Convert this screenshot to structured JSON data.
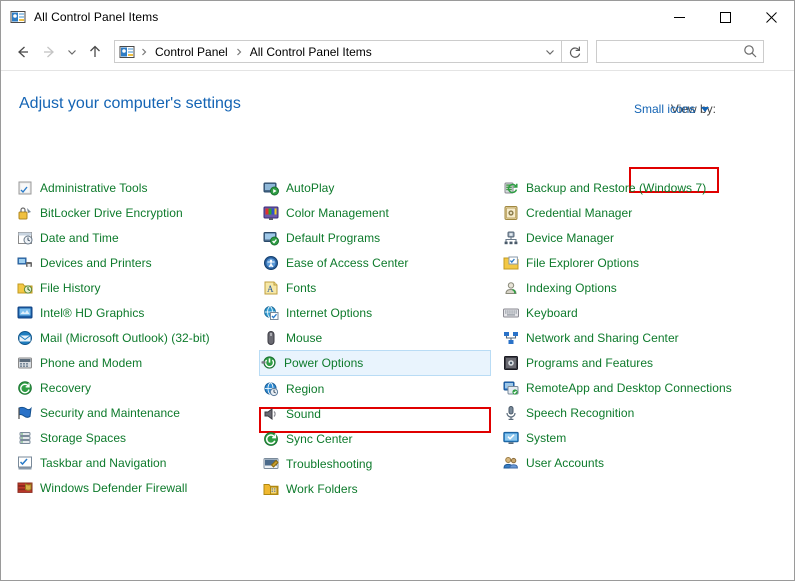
{
  "window": {
    "title": "All Control Panel Items",
    "icon": "control-panel-icon",
    "buttons": {
      "minimize": "minimize-icon",
      "maximize": "maximize-icon",
      "close": "close-icon"
    }
  },
  "navbar": {
    "back": "back-arrow-icon",
    "forward": "forward-arrow-icon",
    "recent": "recent-locations-icon",
    "up": "up-arrow-icon",
    "refresh": "refresh-icon",
    "breadcrumbs": [
      "Control Panel",
      "All Control Panel Items"
    ],
    "address_dropdown": "chevron-down-icon",
    "search": {
      "value": "",
      "placeholder": "",
      "icon": "search-icon"
    }
  },
  "header": {
    "page_title": "Adjust your computer's settings",
    "view_by_label": "View by:",
    "view_by_value": "Small icons"
  },
  "colors": {
    "link_green": "#0d7a2b",
    "heading_blue": "#1464b4",
    "accent_blue": "#1464b4",
    "annotation_red": "#e00000",
    "selection_fill": "#e9f4fd",
    "selection_border": "#b9dcf5"
  },
  "annotations": [
    {
      "name": "view-by-highlight",
      "target": "Small icons"
    },
    {
      "name": "power-options-highlight",
      "target": "Power Options"
    }
  ],
  "selected_item": "Power Options",
  "columns": [
    {
      "items": [
        {
          "label": "Administrative Tools",
          "icon": "administrative-tools-icon"
        },
        {
          "label": "BitLocker Drive Encryption",
          "icon": "bitlocker-icon"
        },
        {
          "label": "Date and Time",
          "icon": "date-and-time-icon"
        },
        {
          "label": "Devices and Printers",
          "icon": "devices-and-printers-icon"
        },
        {
          "label": "File History",
          "icon": "file-history-icon"
        },
        {
          "label": "Intel® HD Graphics",
          "icon": "intel-hd-graphics-icon"
        },
        {
          "label": "Mail (Microsoft Outlook) (32-bit)",
          "icon": "mail-icon"
        },
        {
          "label": "Phone and Modem",
          "icon": "phone-and-modem-icon"
        },
        {
          "label": "Recovery",
          "icon": "recovery-icon"
        },
        {
          "label": "Security and Maintenance",
          "icon": "security-and-maintenance-icon"
        },
        {
          "label": "Storage Spaces",
          "icon": "storage-spaces-icon"
        },
        {
          "label": "Taskbar and Navigation",
          "icon": "taskbar-and-navigation-icon"
        },
        {
          "label": "Windows Defender Firewall",
          "icon": "windows-defender-firewall-icon"
        }
      ]
    },
    {
      "items": [
        {
          "label": "AutoPlay",
          "icon": "autoplay-icon"
        },
        {
          "label": "Color Management",
          "icon": "color-management-icon"
        },
        {
          "label": "Default Programs",
          "icon": "default-programs-icon"
        },
        {
          "label": "Ease of Access Center",
          "icon": "ease-of-access-icon"
        },
        {
          "label": "Fonts",
          "icon": "fonts-icon"
        },
        {
          "label": "Internet Options",
          "icon": "internet-options-icon"
        },
        {
          "label": "Mouse",
          "icon": "mouse-icon"
        },
        {
          "label": "Power Options",
          "icon": "power-options-icon"
        },
        {
          "label": "Region",
          "icon": "region-icon"
        },
        {
          "label": "Sound",
          "icon": "sound-icon"
        },
        {
          "label": "Sync Center",
          "icon": "sync-center-icon"
        },
        {
          "label": "Troubleshooting",
          "icon": "troubleshooting-icon"
        },
        {
          "label": "Work Folders",
          "icon": "work-folders-icon"
        }
      ]
    },
    {
      "items": [
        {
          "label": "Backup and Restore (Windows 7)",
          "icon": "backup-and-restore-icon"
        },
        {
          "label": "Credential Manager",
          "icon": "credential-manager-icon"
        },
        {
          "label": "Device Manager",
          "icon": "device-manager-icon"
        },
        {
          "label": "File Explorer Options",
          "icon": "file-explorer-options-icon"
        },
        {
          "label": "Indexing Options",
          "icon": "indexing-options-icon"
        },
        {
          "label": "Keyboard",
          "icon": "keyboard-icon"
        },
        {
          "label": "Network and Sharing Center",
          "icon": "network-and-sharing-icon"
        },
        {
          "label": "Programs and Features",
          "icon": "programs-and-features-icon"
        },
        {
          "label": "RemoteApp and Desktop Connections",
          "icon": "remoteapp-icon"
        },
        {
          "label": "Speech Recognition",
          "icon": "speech-recognition-icon"
        },
        {
          "label": "System",
          "icon": "system-icon"
        },
        {
          "label": "User Accounts",
          "icon": "user-accounts-icon"
        }
      ]
    }
  ]
}
